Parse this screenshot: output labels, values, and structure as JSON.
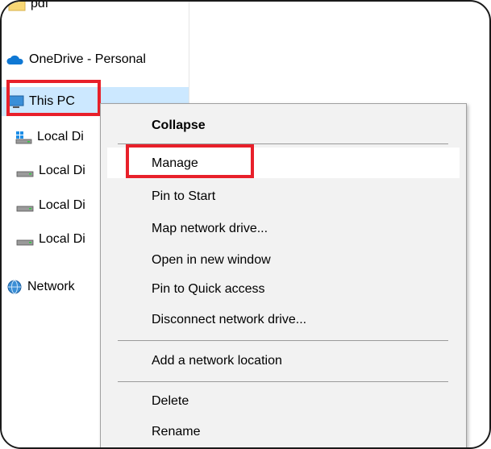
{
  "nav": {
    "items": [
      {
        "label": "pdf",
        "icon": "folder-icon"
      },
      {
        "label": "OneDrive - Personal",
        "icon": "onedrive-cloud-icon"
      },
      {
        "label": "This PC",
        "icon": "this-pc-icon",
        "selected": true
      },
      {
        "label": "Local Di",
        "icon": "windows-drive-icon"
      },
      {
        "label": "Local Di",
        "icon": "drive-icon"
      },
      {
        "label": "Local Di",
        "icon": "drive-icon"
      },
      {
        "label": "Local Di",
        "icon": "drive-icon"
      },
      {
        "label": "Network",
        "icon": "network-globe-icon"
      }
    ]
  },
  "context_menu": {
    "items": [
      {
        "label": "Collapse",
        "bold": true
      },
      {
        "label": "Manage",
        "highlighted": true
      },
      {
        "label": "Pin to Start"
      },
      {
        "label": "Map network drive..."
      },
      {
        "label": "Open in new window"
      },
      {
        "label": "Pin to Quick access"
      },
      {
        "label": "Disconnect network drive..."
      },
      {
        "label": "Add a network location"
      },
      {
        "label": "Delete"
      },
      {
        "label": "Rename"
      }
    ]
  },
  "colors": {
    "highlight_box": "#e8202a",
    "selection": "#cce8ff",
    "menu_background": "#f2f2f2"
  }
}
